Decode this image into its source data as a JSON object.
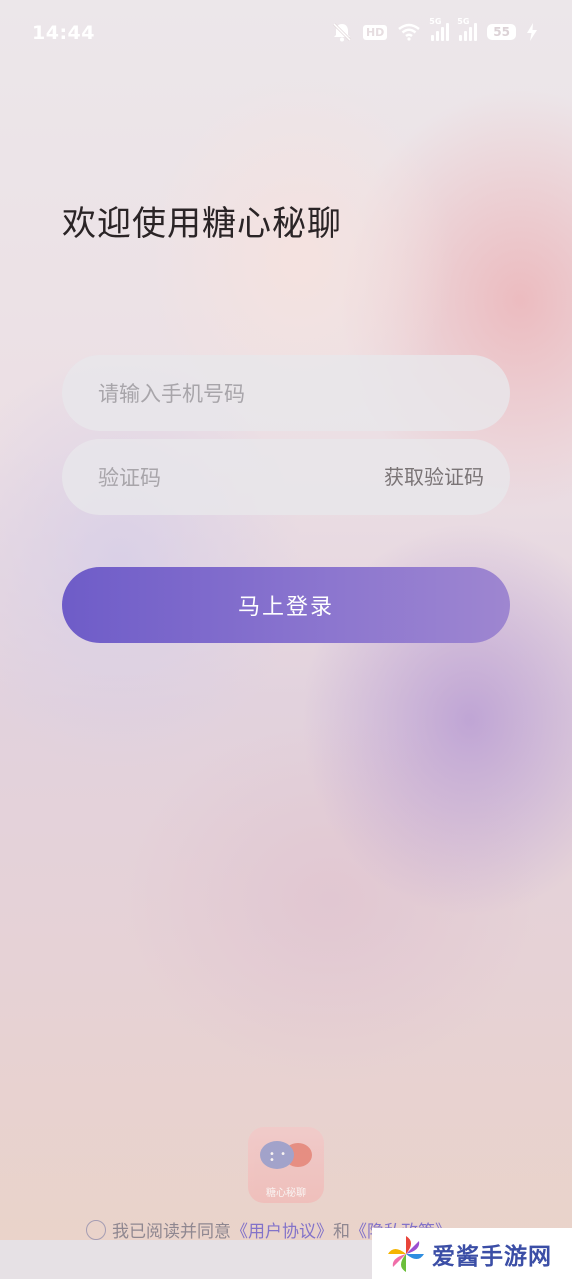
{
  "status_bar": {
    "time": "14:44",
    "hd_badge": "HD",
    "network_1": "5G",
    "network_2": "5G",
    "battery": "55"
  },
  "login": {
    "title": "欢迎使用糖心秘聊",
    "phone_placeholder": "请输入手机号码",
    "code_placeholder": "验证码",
    "get_code_label": "获取验证码",
    "login_button": "马上登录"
  },
  "app_logo": {
    "name": "糖心秘聊"
  },
  "agreement": {
    "prefix": "我已阅读并同意",
    "user_agreement": "《用户协议》",
    "conjunction": "和",
    "privacy_policy": "《隐私政策》"
  },
  "watermark": {
    "text": "爱酱手游网"
  },
  "colors": {
    "accent_start": "#6e5cc8",
    "accent_end": "#9e86d0",
    "link": "#8373c9"
  }
}
